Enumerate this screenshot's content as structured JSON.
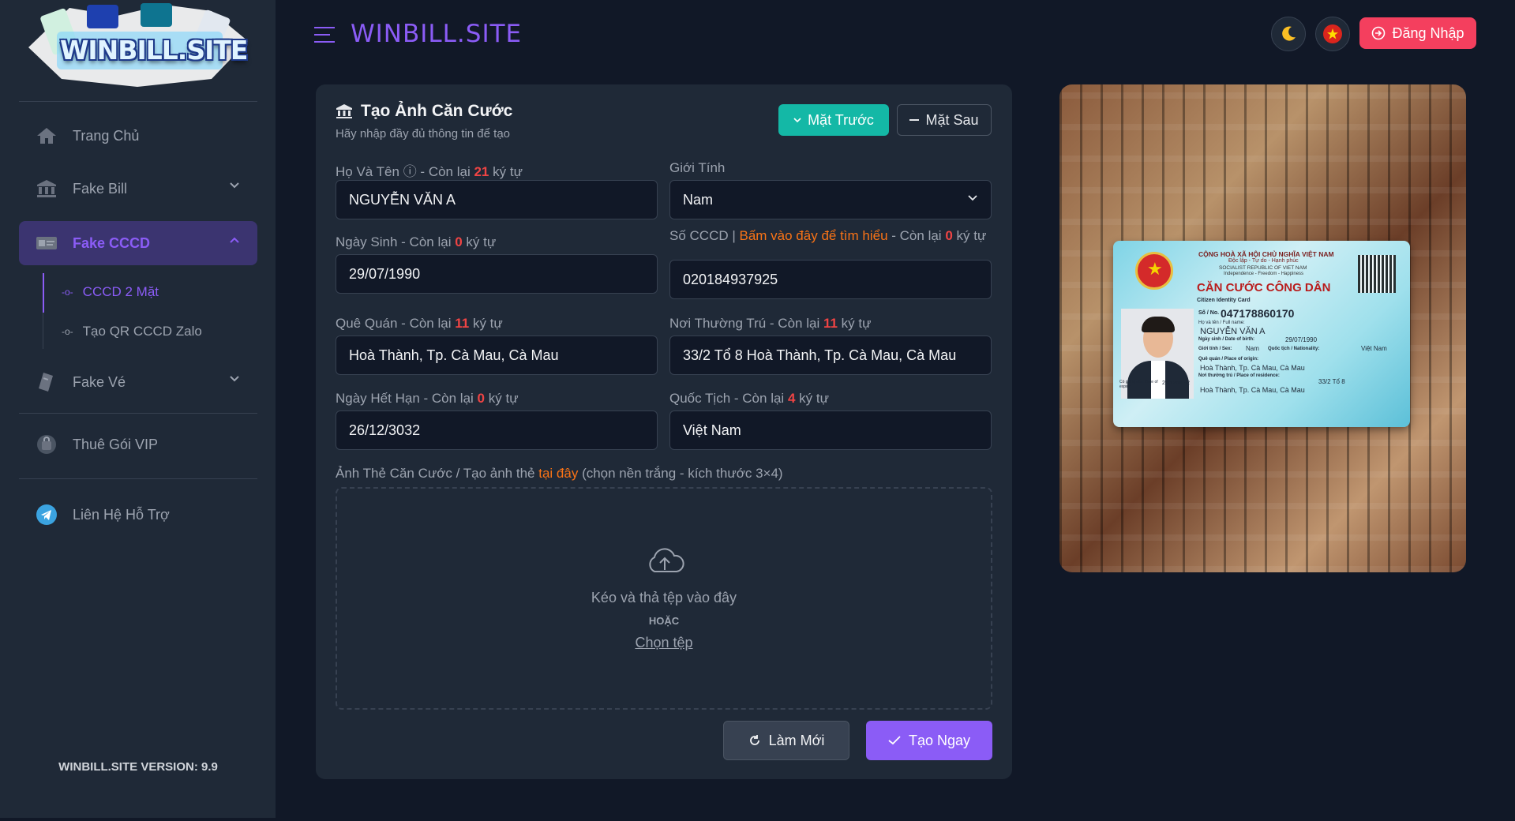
{
  "sidebar": {
    "logo_text": "WINBILL.SITE",
    "items": [
      {
        "label": "Trang Chủ",
        "icon": "home-icon"
      },
      {
        "label": "Fake Bill",
        "icon": "bank-icon"
      },
      {
        "label": "Fake CCCD",
        "icon": "card-icon"
      },
      {
        "label": "Fake Vé",
        "icon": "ticket-icon"
      },
      {
        "label": "Thuê Gói VIP",
        "icon": "bag-icon"
      },
      {
        "label": "Liên Hệ Hỗ Trợ",
        "icon": "telegram-icon"
      }
    ],
    "sub_items": [
      {
        "label": "CCCD 2 Mặt"
      },
      {
        "label": "Tạo QR CCCD Zalo"
      }
    ],
    "version": "WINBILL.SITE VERSION: 9.9"
  },
  "header": {
    "brand": "WINBILL.SITE",
    "login_label": "Đăng Nhập"
  },
  "form": {
    "title": "Tạo Ảnh Căn Cước",
    "subtitle": "Hãy nhập đầy đủ thông tin để tạo",
    "front_label": "Mặt Trước",
    "back_label": "Mặt Sau",
    "remaining": "Còn lại",
    "chars": "ký tự",
    "name": {
      "label": "Họ Và Tên",
      "count": "21",
      "value": "NGUYỄN VĂN A"
    },
    "gender": {
      "label": "Giới Tính",
      "value": "Nam"
    },
    "dob": {
      "label": "Ngày Sinh",
      "count": "0",
      "value": "29/07/1990"
    },
    "id_number": {
      "label": "Số CCCD",
      "hint": "Bấm vào đây để tìm hiểu",
      "count": "0",
      "value": "020184937925"
    },
    "hometown": {
      "label": "Quê Quán",
      "count": "11",
      "value": "Hoà Thành, Tp. Cà Mau, Cà Mau"
    },
    "residence": {
      "label": "Nơi Thường Trú",
      "count": "11",
      "value": "33/2 Tổ 8 Hoà Thành, Tp. Cà Mau, Cà Mau"
    },
    "expiry": {
      "label": "Ngày Hết Hạn",
      "count": "0",
      "value": "26/12/3032"
    },
    "nationality": {
      "label": "Quốc Tịch",
      "count": "4",
      "value": "Việt Nam"
    },
    "photo": {
      "label_pre": "Ảnh Thẻ Căn Cước / Tạo ảnh thẻ",
      "label_link": "tại đây",
      "label_post": "(chọn nền trắng - kích thước 3×4)",
      "drop_text": "Kéo và thả tệp vào đây",
      "or_text": "HOẶC",
      "choose_text": "Chọn tệp"
    },
    "reset_label": "Làm Mới",
    "create_label": "Tạo Ngay"
  },
  "preview": {
    "l1": "CỘNG HOÀ XÃ HỘI CHỦ NGHĨA VIỆT NAM",
    "l2": "Độc lập - Tự do - Hạnh phúc",
    "l3": "SOCIALIST REPUBLIC OF VIET NAM",
    "l4": "Independence - Freedom - Happiness",
    "title": "CĂN CƯỚC CÔNG DÂN",
    "sub": "Citizen Identity Card",
    "number_label": "Số / No.",
    "number": "047178860170",
    "name_label": "Họ và tên / Full name:",
    "name": "NGUYỄN VĂN A",
    "dob_label": "Ngày sinh / Date of birth:",
    "dob": "29/07/1990",
    "sex_label": "Giới tính / Sex:",
    "sex": "Nam",
    "nat_label": "Quốc tịch / Nationality:",
    "nat": "Việt Nam",
    "origin_label": "Quê quán / Place of origin:",
    "origin": "Hoà Thành, Tp. Cà Mau, Cà Mau",
    "res_label": "Nơi thường trú / Place of residence:",
    "res1": "33/2 Tổ 8",
    "res2": "Hoà Thành, Tp. Cà Mau, Cà Mau",
    "exp_label": "Có giá trị đến: Date of expiry",
    "exp": "26/12/3032"
  }
}
